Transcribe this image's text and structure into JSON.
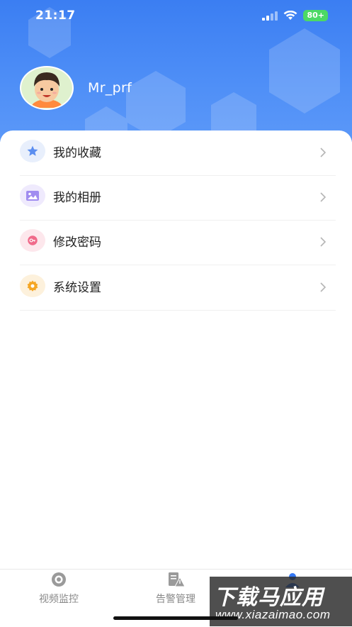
{
  "status_bar": {
    "time": "21:17",
    "battery": "80+"
  },
  "profile": {
    "username": "Mr_prf"
  },
  "menu": [
    {
      "label": "我的收藏",
      "icon": "star-icon",
      "color": "#5b8ef0"
    },
    {
      "label": "我的相册",
      "icon": "photo-album-icon",
      "color": "#a08cf0"
    },
    {
      "label": "修改密码",
      "icon": "key-icon",
      "color": "#f06a8a"
    },
    {
      "label": "系统设置",
      "icon": "gear-icon",
      "color": "#f5a623"
    }
  ],
  "tabbar": {
    "tabs": [
      {
        "label": "视频监控",
        "icon": "camera-eye-icon"
      },
      {
        "label": "告警管理",
        "icon": "alert-document-icon"
      },
      {
        "label": "",
        "icon": "user-icon",
        "active": true
      }
    ]
  },
  "watermark": {
    "main": "下载马应用",
    "sub": "www.xiazaimao.com"
  },
  "colors": {
    "header_blue": "#3b7ef2",
    "accent_blue": "#3478f6",
    "battery_green": "#4cd964"
  }
}
